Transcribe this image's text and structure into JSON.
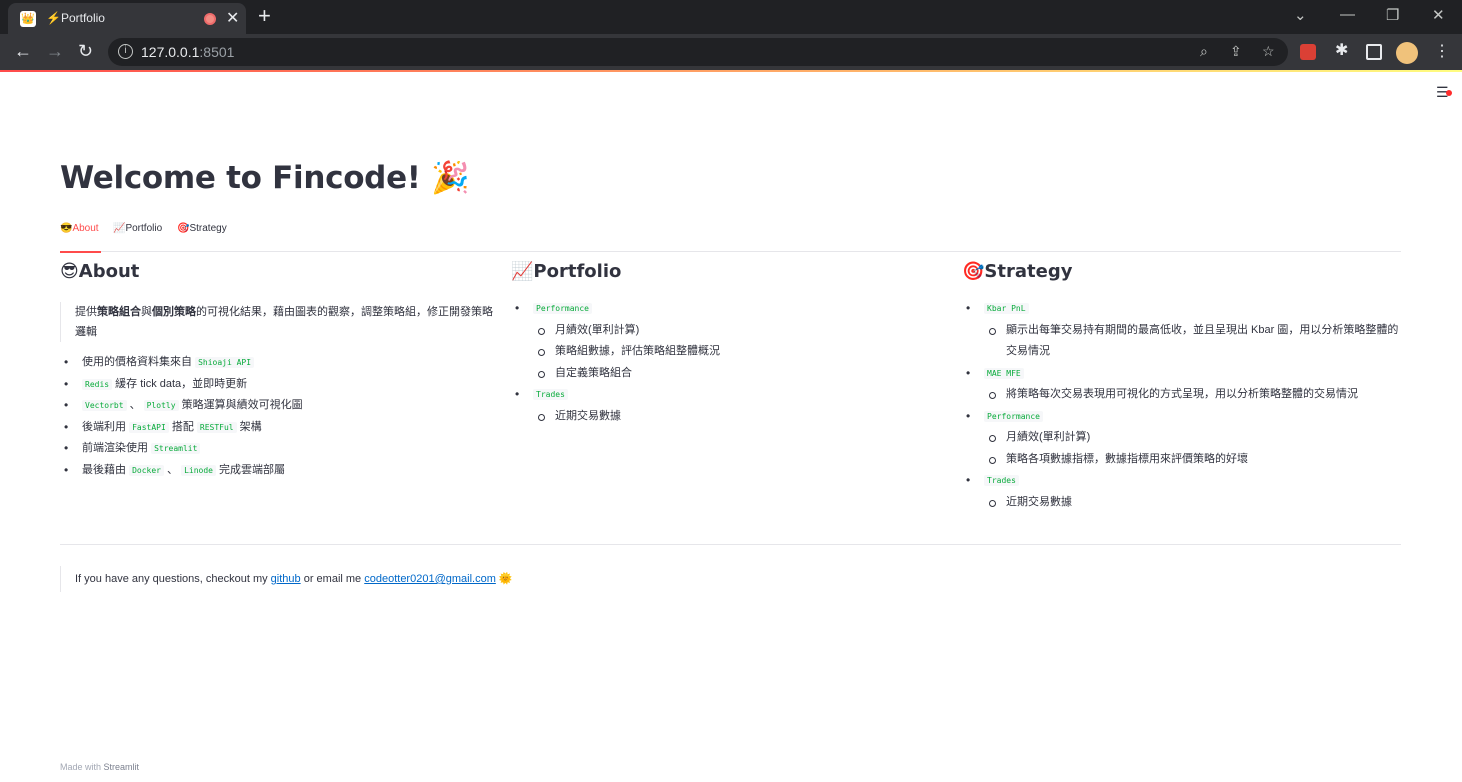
{
  "browser": {
    "tab_title": "⚡Portfolio",
    "tab_favicon": "streamlit-icon",
    "url_host": "127.0.0.1",
    "url_port": ":8501"
  },
  "app": {
    "title": "Welcome to Fincode! 🎉",
    "tabs": [
      {
        "label": "😎About",
        "active": true
      },
      {
        "label": "📈Portfolio",
        "active": false
      },
      {
        "label": "🎯Strategy",
        "active": false
      }
    ],
    "about": {
      "heading": "😎About",
      "intro_pre": "提供",
      "intro_b1": "策略組合",
      "intro_mid": "與",
      "intro_b2": "個別策略",
      "intro_post": "的可視化結果，藉由圖表的觀察，調整策略組，修正開發策略邏輯",
      "items": [
        {
          "pre": "使用的價格資料集來自 ",
          "code1": "Shioaji API",
          "mid": "",
          "code2": "",
          "post": ""
        },
        {
          "pre": "",
          "code1": "Redis",
          "mid": " 緩存 tick data，並即時更新",
          "code2": "",
          "post": ""
        },
        {
          "pre": "",
          "code1": "Vectorbt",
          "mid": " 、 ",
          "code2": "Plotly",
          "post": " 策略運算與績效可視化圖"
        },
        {
          "pre": "後端利用 ",
          "code1": "FastAPI",
          "mid": " 搭配 ",
          "code2": "RESTFul",
          "post": " 架構"
        },
        {
          "pre": "前端渲染使用 ",
          "code1": "Streamlit",
          "mid": "",
          "code2": "",
          "post": ""
        },
        {
          "pre": "最後藉由 ",
          "code1": "Docker",
          "mid": " 、 ",
          "code2": "Linode",
          "post": " 完成雲端部屬"
        }
      ]
    },
    "portfolio": {
      "heading": "📈Portfolio",
      "item1": "Performance",
      "item1_subs": [
        "月績效(單利計算)",
        "策略組數據，評估策略組整體概況",
        "自定義策略組合"
      ],
      "item2": "Trades",
      "item2_subs": [
        "近期交易數據"
      ]
    },
    "strategy": {
      "heading": "🎯Strategy",
      "item1": "Kbar PnL",
      "item1_subs": [
        "顯示出每筆交易持有期間的最高低收，並且呈現出 Kbar 圖，用以分析策略整體的交易情況"
      ],
      "item2": "MAE MFE",
      "item2_subs": [
        "將策略每次交易表現用可視化的方式呈現，用以分析策略整體的交易情況"
      ],
      "item3": "Performance",
      "item3_subs": [
        "月績效(單利計算)",
        "策略各項數據指標，數據指標用來評價策略的好壞"
      ],
      "item4": "Trades",
      "item4_subs": [
        "近期交易數據"
      ]
    },
    "footer": {
      "pre": "If you have any questions, checkout my ",
      "link1": "github",
      "mid": " or email me ",
      "link2": "codeotter0201@gmail.com",
      "post": " 🌞"
    },
    "made_with_pre": "Made with ",
    "made_with_brand": "Streamlit"
  }
}
